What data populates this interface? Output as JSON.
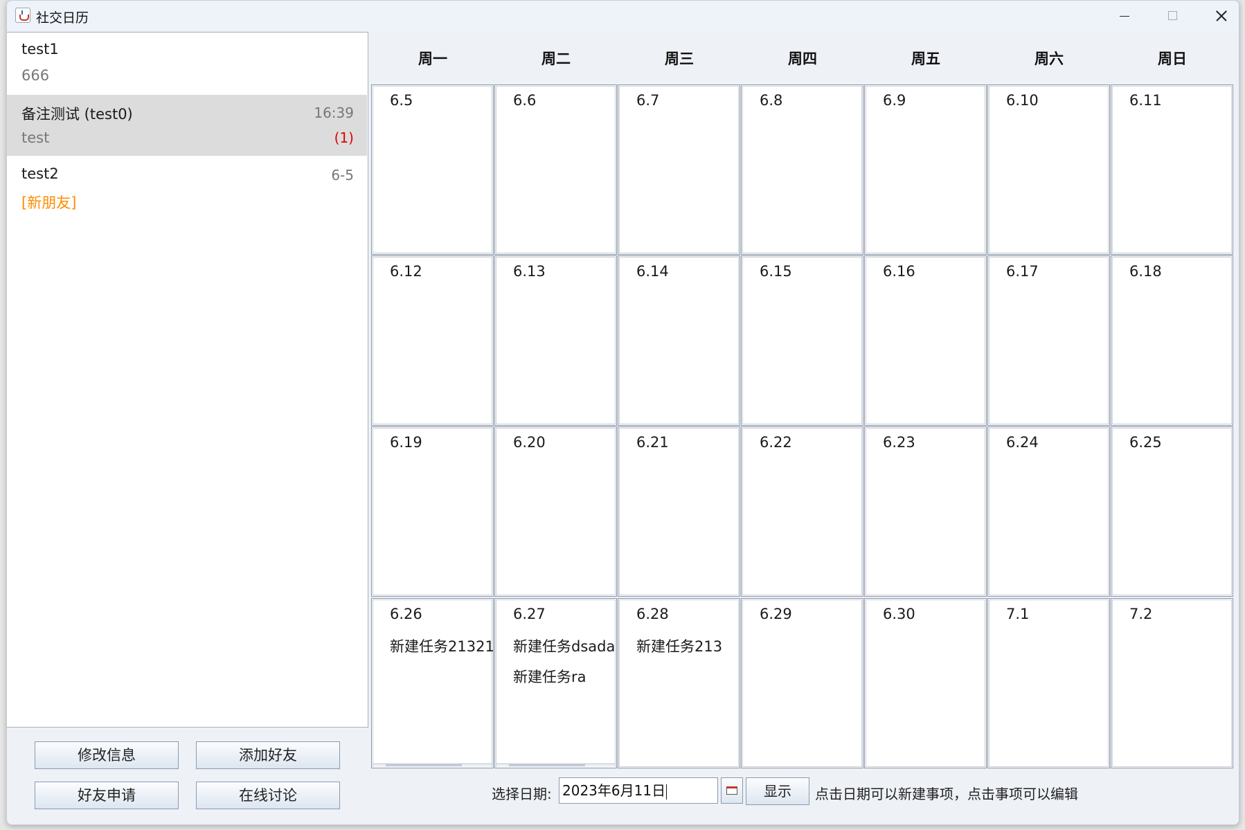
{
  "window": {
    "title": "社交日历"
  },
  "contacts": [
    {
      "name": "test1",
      "time": "",
      "message": "666",
      "unread": ""
    },
    {
      "name": "备注测试 (test0)",
      "time": "16:39",
      "message": "test",
      "unread": "(1)"
    },
    {
      "name": "test2",
      "time": "6-5",
      "message": "[新朋友]",
      "unread": ""
    }
  ],
  "buttons": {
    "edit_info": "修改信息",
    "add_friend": "添加好友",
    "friend_requests": "好友申请",
    "online_discussion": "在线讨论"
  },
  "calendar": {
    "weekdays": [
      "周一",
      "周二",
      "周三",
      "周四",
      "周五",
      "周六",
      "周日"
    ],
    "weeks": [
      [
        {
          "date": "6.5",
          "tasks": []
        },
        {
          "date": "6.6",
          "tasks": []
        },
        {
          "date": "6.7",
          "tasks": []
        },
        {
          "date": "6.8",
          "tasks": []
        },
        {
          "date": "6.9",
          "tasks": []
        },
        {
          "date": "6.10",
          "tasks": []
        },
        {
          "date": "6.11",
          "tasks": []
        }
      ],
      [
        {
          "date": "6.12",
          "tasks": []
        },
        {
          "date": "6.13",
          "tasks": []
        },
        {
          "date": "6.14",
          "tasks": []
        },
        {
          "date": "6.15",
          "tasks": []
        },
        {
          "date": "6.16",
          "tasks": []
        },
        {
          "date": "6.17",
          "tasks": []
        },
        {
          "date": "6.18",
          "tasks": []
        }
      ],
      [
        {
          "date": "6.19",
          "tasks": []
        },
        {
          "date": "6.20",
          "tasks": []
        },
        {
          "date": "6.21",
          "tasks": []
        },
        {
          "date": "6.22",
          "tasks": []
        },
        {
          "date": "6.23",
          "tasks": []
        },
        {
          "date": "6.24",
          "tasks": []
        },
        {
          "date": "6.25",
          "tasks": []
        }
      ],
      [
        {
          "date": "6.26",
          "tasks": [
            "新建任务21321"
          ]
        },
        {
          "date": "6.27",
          "tasks": [
            "新建任务dsada",
            "新建任务ra"
          ]
        },
        {
          "date": "6.28",
          "tasks": [
            "新建任务213"
          ]
        },
        {
          "date": "6.29",
          "tasks": []
        },
        {
          "date": "6.30",
          "tasks": []
        },
        {
          "date": "7.1",
          "tasks": []
        },
        {
          "date": "7.2",
          "tasks": []
        }
      ]
    ]
  },
  "date_picker": {
    "label": "选择日期:",
    "value": "2023年6月11日",
    "show_label": "显示",
    "hint": "点击日期可以新建事项，点击事项可以编辑"
  },
  "colors": {
    "unread": "#e00000",
    "new_friend": "#ff8c00",
    "selected_row": "#dcdcdc"
  }
}
